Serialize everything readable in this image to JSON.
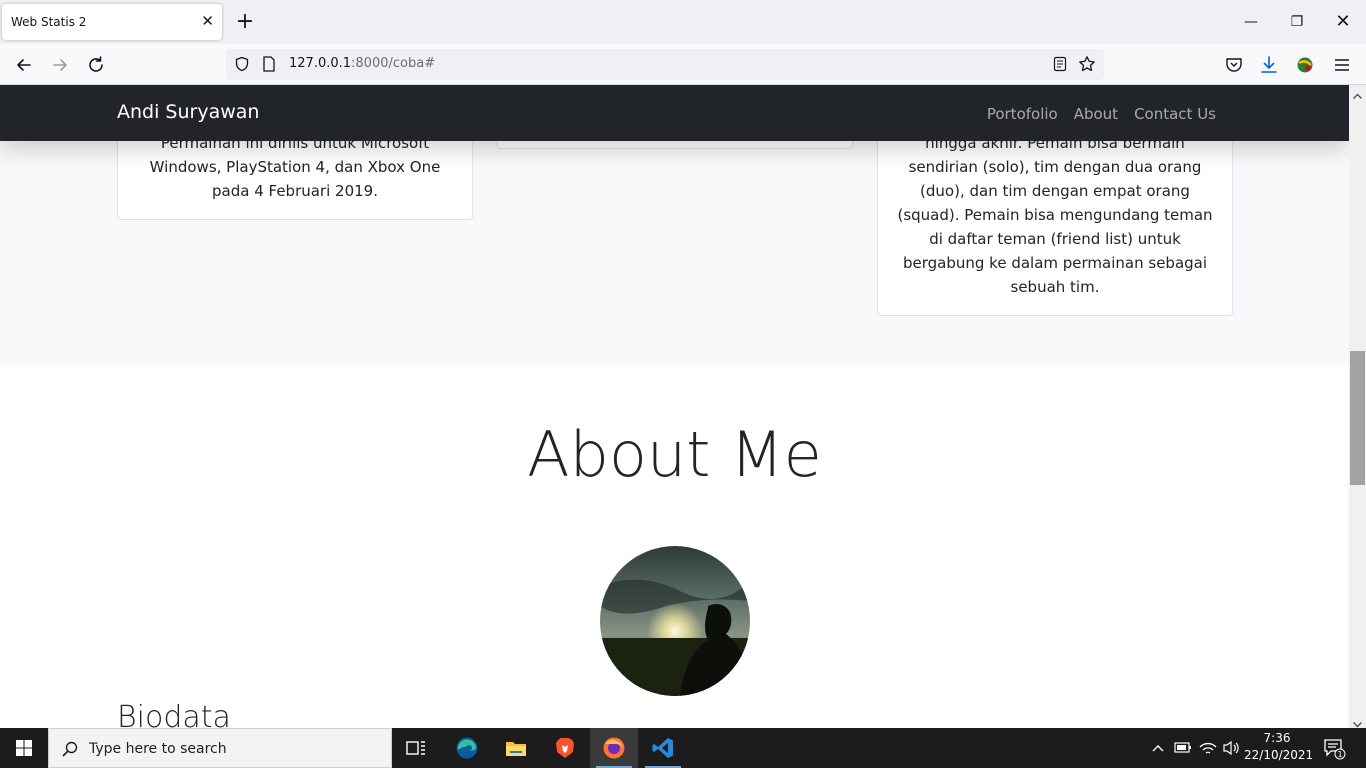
{
  "browser": {
    "tab_title": "Web Statis 2",
    "tab_close": "✕",
    "new_tab": "+",
    "url_host": "127.0.0.1",
    "url_path": ":8000/coba#",
    "window_min": "—",
    "window_max": "❐",
    "window_close": "✕"
  },
  "site": {
    "brand": "Andi Suryawan",
    "nav": [
      "Portofolio",
      "About",
      "Contact Us"
    ],
    "cards": [
      {
        "text": "Permainan ini dirilis untuk Microsoft Windows, PlayStation 4, dan Xbox One pada 4 Februari 2019."
      },
      {
        "text": ""
      },
      {
        "text": "individu atau tim yang dapat bertahan hingga akhir. Pemain bisa bermain sendirian (solo), tim dengan dua orang (duo), dan tim dengan empat orang (squad). Pemain bisa mengundang teman di daftar teman (friend list) untuk bergabung ke dalam permainan sebagai sebuah tim."
      }
    ],
    "about_title": "About Me",
    "biodata_title": "Biodata"
  },
  "taskbar": {
    "search_placeholder": "Type here to search",
    "time": "7:36",
    "date": "22/10/2021",
    "notification_count": "1"
  },
  "colors": {
    "site_nav_bg": "#212529",
    "section_bg": "#f8f9fa",
    "taskbar_bg": "#1c1c1c"
  },
  "icons": [
    "back-icon",
    "forward-icon",
    "reload-icon",
    "shield-icon",
    "page-icon",
    "reader-view-icon",
    "star-icon",
    "pocket-icon",
    "download-icon",
    "extension-icon",
    "menu-icon",
    "windows-start-icon",
    "search-icon",
    "task-view-icon",
    "edge-icon",
    "file-explorer-icon",
    "brave-icon",
    "firefox-icon",
    "vscode-icon",
    "chevron-up-icon",
    "battery-icon",
    "wifi-icon",
    "volume-icon",
    "notification-icon"
  ]
}
